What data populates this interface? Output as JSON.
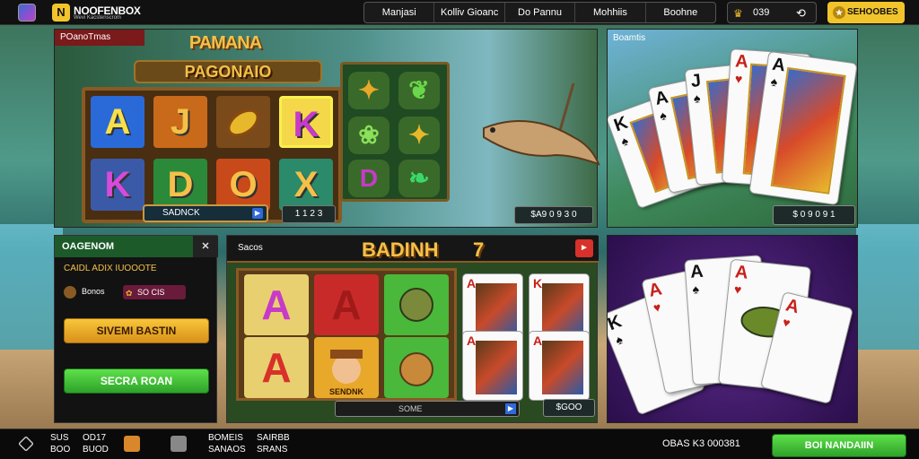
{
  "topbar": {
    "logo_mark": "N",
    "logo_name": "NOOFENBOX",
    "logo_sub": "Wevi Kacstenscrom",
    "nav": [
      "Manjasi",
      "Kolliv Gioanc",
      "Do Pannu",
      "Mohhiis",
      "Boohne"
    ],
    "coins": "039",
    "cta": "SEHOOBES"
  },
  "panelA": {
    "tag": "POanoTmas",
    "title": "PAMANA",
    "subtitle": "PAGONAIO",
    "reels": [
      "A",
      "J",
      "",
      "K",
      "K",
      "D",
      "O",
      "X"
    ],
    "spin_label": "SADNCK",
    "win1": "1 1 2 3",
    "win2": "$A9 0 9 3 0"
  },
  "panelB": {
    "tag": "Boamtis",
    "win": "$ 0 9 0 9 1"
  },
  "panelC": {
    "header": "OAGENOM",
    "close": "✕",
    "label": "CAIDL ADIX IUOOOTE",
    "row_text": "Bonos",
    "row_badge": "SO CIS",
    "btn_yellow": "SIVEMI BASTIN",
    "btn_green": "SECRA ROAN"
  },
  "panelD": {
    "tab": "Sacos",
    "title": "BADINH",
    "title_num": "7",
    "close": "►",
    "cells": [
      "A",
      "A",
      "",
      "A",
      "",
      ""
    ],
    "cell_label": "SENDNK",
    "spin_label": "SOME",
    "win": "$GOO"
  },
  "panelE": {},
  "botbar": {
    "stat1_top": "SUS",
    "stat1_bot": "BOO",
    "stat2_top": "OD17",
    "stat2_bot": "BUOD",
    "stat3_top": "BOMEIS",
    "stat3_bot": "SANAOS",
    "stat4_top": "SAIRBB",
    "stat4_bot": "SRANS",
    "balance": "OBAS  K3 000381",
    "cta": "BOI NANDAIIN"
  },
  "colors": {
    "gold": "#f4c048",
    "green": "#2ea22a",
    "yellow": "#f2c42c",
    "red": "#d8302a"
  }
}
